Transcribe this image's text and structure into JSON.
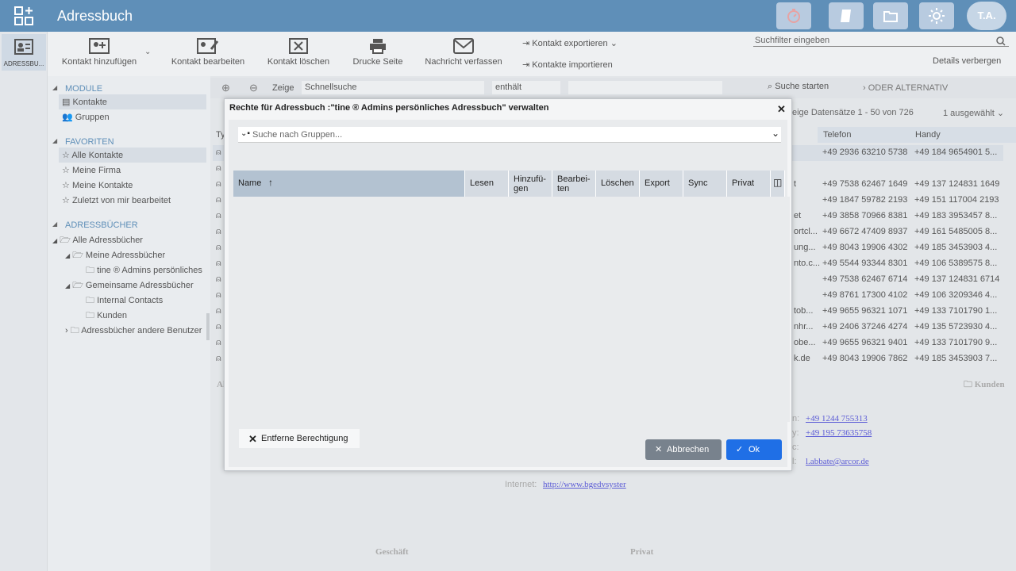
{
  "app": {
    "title": "Adressbuch",
    "avatar": "T.A.",
    "module_label": "ADRESSBU..."
  },
  "toolbar": {
    "add": "Kontakt hinzufügen",
    "edit": "Kontakt bearbeiten",
    "delete": "Kontakt löschen",
    "print": "Drucke Seite",
    "message": "Nachricht verfassen",
    "export": "Kontakt exportieren",
    "import": "Kontakte importieren",
    "search_placeholder": "Suchfilter eingeben",
    "details_hide": "Details verbergen"
  },
  "tree": {
    "modules_header": "MODULE",
    "contacts": "Kontakte",
    "groups": "Gruppen",
    "favorites_header": "FAVORITEN",
    "fav_all": "Alle Kontakte",
    "fav_company": "Meine Firma",
    "fav_mine": "Meine Kontakte",
    "fav_recent": "Zuletzt von mir bearbeitet",
    "books_header": "ADRESSBÜCHER",
    "all_books": "Alle Adressbücher",
    "my_books": "Meine Adressbücher",
    "personal_book": "tine ® Admins persönliches",
    "shared_books": "Gemeinsame Adressbücher",
    "internal": "Internal Contacts",
    "customers": "Kunden",
    "other_users": "Adressbücher andere Benutzer"
  },
  "filter": {
    "show": "Zeige",
    "quick": "Schnellsuche",
    "contains": "enthält",
    "start": "Suche starten",
    "or_alt": "ODER ALTERNATIV",
    "records": "eige Datensätze 1 - 50 von 726",
    "selected": "1 ausgewählt"
  },
  "grid": {
    "col_type": "Ty",
    "col_phone": "Telefon",
    "col_mobile": "Handy",
    "rows": [
      {
        "frag": "",
        "phone": "+49 2936 63210 5738",
        "mobile": "+49 184 9654901 5..."
      },
      {
        "frag": "",
        "phone": "",
        "mobile": ""
      },
      {
        "frag": "t",
        "phone": "+49 7538 62467 1649",
        "mobile": "+49 137 124831 1649"
      },
      {
        "frag": "",
        "phone": "+49 1847 59782 2193",
        "mobile": "+49 151 117004 2193"
      },
      {
        "frag": "et",
        "phone": "+49 3858 70966 8381",
        "mobile": "+49 183 3953457 8..."
      },
      {
        "frag": "ortcl...",
        "phone": "+49 6672 47409 8937",
        "mobile": "+49 161 5485005 8..."
      },
      {
        "frag": "ung...",
        "phone": "+49 8043 19906 4302",
        "mobile": "+49 185 3453903 4..."
      },
      {
        "frag": "nto.c...",
        "phone": "+49 5544 93344 8301",
        "mobile": "+49 106 5389575 8..."
      },
      {
        "frag": "",
        "phone": "+49 7538 62467 6714",
        "mobile": "+49 137 124831 6714"
      },
      {
        "frag": "",
        "phone": "+49 8761 17300 4102",
        "mobile": "+49 106 3209346 4..."
      },
      {
        "frag": "tob...",
        "phone": "+49 9655 96321 1071",
        "mobile": "+49 133 7101790 1..."
      },
      {
        "frag": "nhr...",
        "phone": "+49 2406 37246 4274",
        "mobile": "+49 135 5723930 4..."
      },
      {
        "frag": "obe...",
        "phone": "+49 9655 96321 9401",
        "mobile": "+49 133 7101790 9..."
      },
      {
        "frag": "k.de",
        "phone": "+49 8043 19906 7862",
        "mobile": "+49 185 3453903 7..."
      }
    ]
  },
  "details": {
    "folder": "Kunden",
    "al": "Al",
    "phone1": "+49 1244 755313",
    "phone2": "+49 195 73635758",
    "email": "l.abbate@arcor.de",
    "internet_label": "Internet:",
    "internet": "http://www.bgedvsyster",
    "business": "Geschäft",
    "private": "Privat",
    "lbl_n": "n:",
    "lbl_y": "y:",
    "lbl_c": "c:",
    "lbl_l": "l:"
  },
  "dialog": {
    "title": "Rechte für Adressbuch :\"tine ® Admins persönliches Adressbuch\" verwalten",
    "search_placeholder": "Suche nach Gruppen...",
    "col_name": "Name",
    "col_read": "Lesen",
    "col_add_1": "Hinzufü-",
    "col_add_2": "gen",
    "col_edit_1": "Bearbei-",
    "col_edit_2": "ten",
    "col_delete": "Löschen",
    "col_export": "Export",
    "col_sync": "Sync",
    "col_private": "Privat",
    "remove": "Entferne Berechtigung",
    "cancel": "Abbrechen",
    "ok": "Ok"
  },
  "colors": {
    "topbar": "#5f8fb8",
    "ok": "#1f6fe6",
    "cancel": "#78828d"
  }
}
